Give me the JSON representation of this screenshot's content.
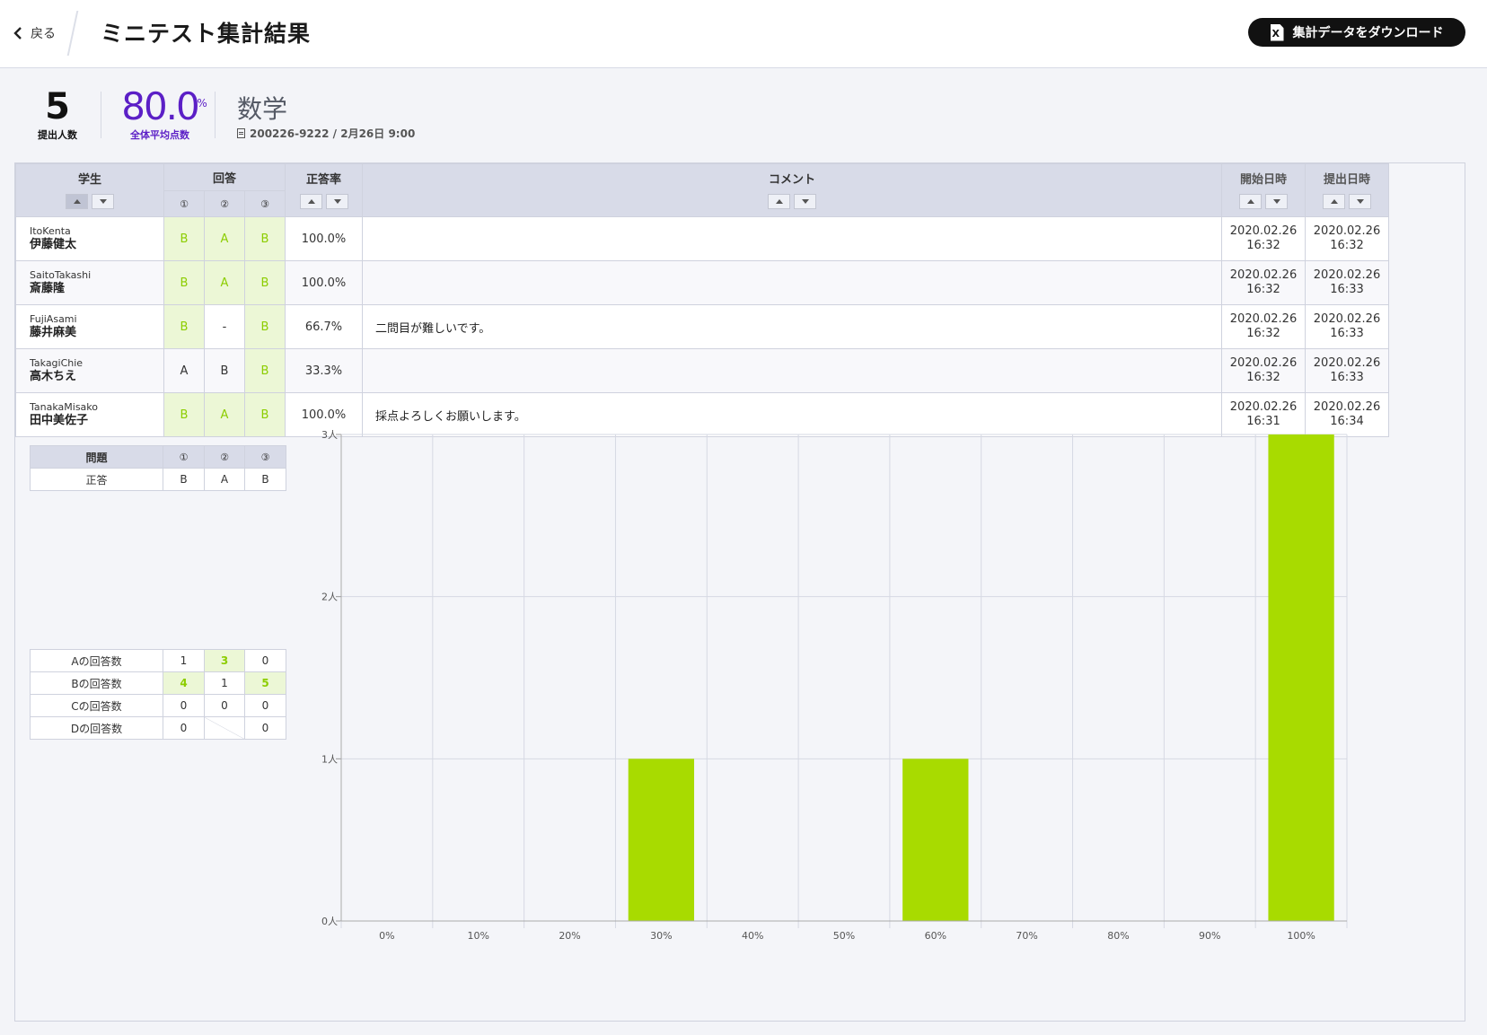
{
  "header": {
    "back_label": "戻る",
    "title": "ミニテスト集計結果",
    "download_label": "集計データをダウンロード",
    "download_icon_letter": "X"
  },
  "summary": {
    "count": "5",
    "count_label": "提出人数",
    "average": "80.0",
    "average_unit": "%",
    "average_label": "全体平均点数",
    "subject": "数学",
    "test_info": "200226-9222 / 2月26日 9:00"
  },
  "table": {
    "headers": {
      "student": "学生",
      "answer": "回答",
      "q1": "①",
      "q2": "②",
      "q3": "③",
      "rate": "正答率",
      "comment": "コメント",
      "start": "開始日時",
      "submit": "提出日時"
    },
    "rows": [
      {
        "en": "ItoKenta",
        "jp": "伊藤健太",
        "a": [
          "B",
          "A",
          "B"
        ],
        "rate": "100.0%",
        "comment": "",
        "start": [
          "2020.02.26",
          "16:32"
        ],
        "submit": [
          "2020.02.26",
          "16:32"
        ]
      },
      {
        "en": "SaitoTakashi",
        "jp": "斎藤隆",
        "a": [
          "B",
          "A",
          "B"
        ],
        "rate": "100.0%",
        "comment": "",
        "start": [
          "2020.02.26",
          "16:32"
        ],
        "submit": [
          "2020.02.26",
          "16:33"
        ]
      },
      {
        "en": "FujiAsami",
        "jp": "藤井麻美",
        "a": [
          "B",
          "-",
          "B"
        ],
        "rate": "66.7%",
        "comment": "二問目が難しいです。",
        "start": [
          "2020.02.26",
          "16:32"
        ],
        "submit": [
          "2020.02.26",
          "16:33"
        ]
      },
      {
        "en": "TakagiChie",
        "jp": "高木ちえ",
        "a": [
          "A",
          "B",
          "B"
        ],
        "rate": "33.3%",
        "comment": "",
        "start": [
          "2020.02.26",
          "16:32"
        ],
        "submit": [
          "2020.02.26",
          "16:33"
        ]
      },
      {
        "en": "TanakaMisako",
        "jp": "田中美佐子",
        "a": [
          "B",
          "A",
          "B"
        ],
        "rate": "100.0%",
        "comment": "採点よろしくお願いします。",
        "start": [
          "2020.02.26",
          "16:31"
        ],
        "submit": [
          "2020.02.26",
          "16:34"
        ]
      }
    ]
  },
  "answer_key": {
    "header": "問題",
    "row_label": "正答",
    "answers": [
      "B",
      "A",
      "B"
    ]
  },
  "answer_counts": {
    "rows": [
      {
        "label": "Aの回答数",
        "values": [
          "1",
          "3",
          "0"
        ]
      },
      {
        "label": "Bの回答数",
        "values": [
          "4",
          "1",
          "5"
        ]
      },
      {
        "label": "Cの回答数",
        "values": [
          "0",
          "0",
          "0"
        ]
      },
      {
        "label": "Dの回答数",
        "values": [
          "0",
          "",
          "0"
        ]
      }
    ]
  },
  "colors": {
    "bar": "#a8db00",
    "correct_bg": "#ecf7d6",
    "correct_text": "#8ccd00",
    "average": "#5b1fc6"
  },
  "chart_data": {
    "type": "bar",
    "categories": [
      "0%",
      "10%",
      "20%",
      "30%",
      "40%",
      "50%",
      "60%",
      "70%",
      "80%",
      "90%",
      "100%"
    ],
    "values": [
      0,
      0,
      0,
      1,
      0,
      0,
      1,
      0,
      0,
      0,
      3
    ],
    "ytick_labels": [
      "0人",
      "1人",
      "2人",
      "3人"
    ],
    "ylim": [
      0,
      3
    ],
    "grid": true
  }
}
